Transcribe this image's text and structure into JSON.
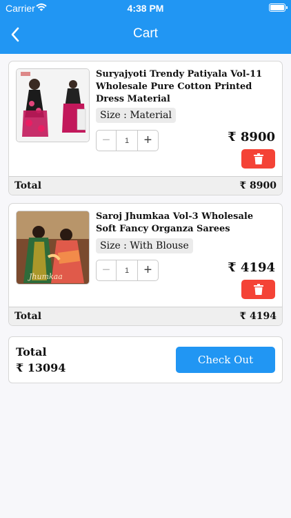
{
  "status_bar": {
    "carrier": "Carrier",
    "time": "4:38 PM"
  },
  "header": {
    "title": "Cart"
  },
  "currency": "₹",
  "items": [
    {
      "name": "Suryajyoti Trendy Patiyala Vol-11 Wholesale Pure Cotton Printed Dress Material",
      "size": "Size : Material",
      "quantity": "1",
      "price": "₹ 8900",
      "total_label": "Total",
      "total_value": "₹ 8900"
    },
    {
      "name": "Saroj Jhumkaa Vol-3 Wholesale Soft Fancy Organza Sarees",
      "size": "Size : With Blouse",
      "quantity": "1",
      "price": "₹ 4194",
      "total_label": "Total",
      "total_value": "₹ 4194",
      "image_caption": "Jhumkaa"
    }
  ],
  "summary": {
    "total_label": "Total",
    "total_value": "₹ 13094",
    "checkout_label": "Check Out"
  },
  "colors": {
    "primary": "#2196f3",
    "danger": "#f44336"
  }
}
